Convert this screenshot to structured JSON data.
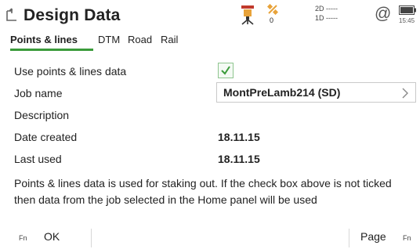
{
  "title_bar": {
    "title": "Design Data",
    "satellites": "0",
    "quality_2d": "2D -----",
    "quality_1d": "1D -----",
    "at_symbol": "@",
    "clock": "15:45",
    "icons": [
      "back-icon",
      "instrument-icon",
      "satellite-icon",
      "at-icon",
      "battery-icon"
    ]
  },
  "tabs": [
    {
      "label": "Points & lines",
      "active": true
    },
    {
      "label": "DTM",
      "active": false
    },
    {
      "label": "Road",
      "active": false
    },
    {
      "label": "Rail",
      "active": false
    }
  ],
  "form": {
    "use_points_label": "Use points & lines data",
    "use_points_checked": true,
    "job_name_label": "Job name",
    "job_name_value": "MontPreLamb214 (SD)",
    "description_label": "Description",
    "date_created_label": "Date created",
    "date_created_value": "18.11.15",
    "last_used_label": "Last used",
    "last_used_value": "18.11.15"
  },
  "info_text": "Points & lines data is used for staking out. If the check box above is not ticked then data from the job selected in the Home panel will be used",
  "softkeys": {
    "fn_left": "Fn",
    "ok_label": "OK",
    "page_label": "Page",
    "fn_right": "Fn"
  },
  "colors": {
    "accent_green": "#3a9b3a",
    "instrument_red": "#c0392b",
    "instrument_orange": "#e8a33a"
  }
}
